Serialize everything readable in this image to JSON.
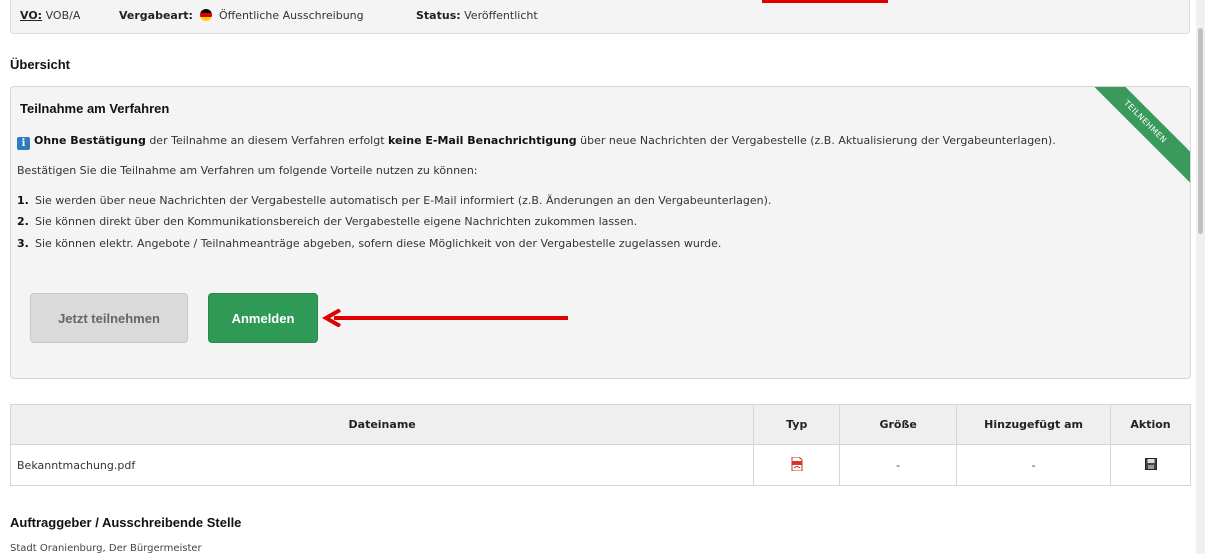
{
  "header": {
    "vo_label": "VO:",
    "vo_value": "VOB/A",
    "vergabeart_label": "Vergabeart:",
    "vergabeart_value": "Öffentliche Ausschreibung",
    "status_label": "Status:",
    "status_value": "Veröffentlicht",
    "flag_colors": [
      "#000000",
      "#dd0000",
      "#ffce00"
    ]
  },
  "overview": {
    "title": "Übersicht"
  },
  "participation": {
    "title": "Teilnahme am Verfahren",
    "ribbon": "TEILNEHMEN",
    "info_bold1": "Ohne Bestätigung",
    "info_text1": " der Teilnahme an diesem Verfahren erfolgt ",
    "info_bold2": "keine E-Mail Benachrichtigung",
    "info_text2": " über neue Nachrichten der Vergabestelle (z.B. Aktualisierung der Vergabeunterlagen).",
    "intro": "Bestätigen Sie die Teilnahme am Verfahren um folgende Vorteile nutzen zu können:",
    "benefits": [
      {
        "num": "1.",
        "text": "Sie werden über neue Nachrichten der Vergabestelle automatisch per E-Mail informiert (z.B. Änderungen an den Vergabeunterlagen)."
      },
      {
        "num": "2.",
        "text": "Sie können direkt über den Kommunikationsbereich der Vergabestelle eigene Nachrichten zukommen lassen."
      },
      {
        "num": "3.",
        "text": "Sie können elektr. Angebote / Teilnahmeanträge abgeben, sofern diese Möglichkeit von der Vergabestelle zugelassen wurde."
      }
    ],
    "btn_join": "Jetzt teilnehmen",
    "btn_login": "Anmelden",
    "accent_color": "#2e9a56"
  },
  "files": {
    "columns": [
      "Dateiname",
      "Typ",
      "Größe",
      "Hinzugefügt am",
      "Aktion"
    ],
    "rows": [
      {
        "name": "Bekanntmachung.pdf",
        "type_icon": "pdf-icon",
        "size": "-",
        "added": "-",
        "action_icon": "save-icon"
      }
    ]
  },
  "client": {
    "title": "Auftraggeber / Ausschreibende Stelle",
    "name": "Stadt Oranienburg, Der Bürgermeister"
  }
}
